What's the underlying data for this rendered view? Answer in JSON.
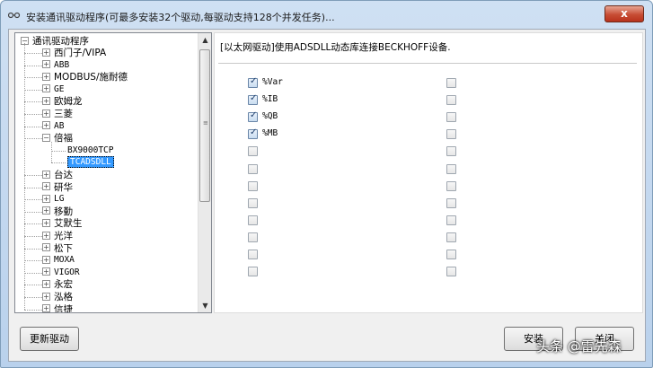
{
  "window": {
    "title": "安装通讯驱动程序(可最多安装32个驱动,每驱动支持128个并发任务)...",
    "close_label": "x"
  },
  "tree": {
    "root_label": "通讯驱动程序",
    "items": [
      {
        "label": "西门子/VIPA",
        "state": "collapsed"
      },
      {
        "label": "ABB",
        "state": "collapsed"
      },
      {
        "label": "MODBUS/施耐德",
        "state": "collapsed"
      },
      {
        "label": "GE",
        "state": "collapsed"
      },
      {
        "label": "欧姆龙",
        "state": "collapsed"
      },
      {
        "label": "三菱",
        "state": "collapsed"
      },
      {
        "label": "AB",
        "state": "collapsed"
      },
      {
        "label": "倍福",
        "state": "expanded"
      },
      {
        "label": "BX9000TCP",
        "state": "child"
      },
      {
        "label": "TCADSDLL",
        "state": "child-selected"
      },
      {
        "label": "台达",
        "state": "collapsed"
      },
      {
        "label": "研华",
        "state": "collapsed"
      },
      {
        "label": "LG",
        "state": "collapsed"
      },
      {
        "label": "移勤",
        "state": "collapsed"
      },
      {
        "label": "艾默生",
        "state": "collapsed"
      },
      {
        "label": "光洋",
        "state": "collapsed"
      },
      {
        "label": "松下",
        "state": "collapsed"
      },
      {
        "label": "MOXA",
        "state": "collapsed"
      },
      {
        "label": "VIGOR",
        "state": "collapsed"
      },
      {
        "label": "永宏",
        "state": "collapsed"
      },
      {
        "label": "泓格",
        "state": "collapsed"
      },
      {
        "label": "信捷",
        "state": "collapsed"
      }
    ]
  },
  "details": {
    "description": "[以太网驱动]使用ADSDLL动态库连接BECKHOFF设备.",
    "left_column": [
      {
        "label": "%Var",
        "checked": true
      },
      {
        "label": "%IB",
        "checked": true
      },
      {
        "label": "%QB",
        "checked": true
      },
      {
        "label": "%MB",
        "checked": true
      },
      {
        "label": "",
        "checked": false
      },
      {
        "label": "",
        "checked": false
      },
      {
        "label": "",
        "checked": false
      },
      {
        "label": "",
        "checked": false
      },
      {
        "label": "",
        "checked": false
      },
      {
        "label": "",
        "checked": false
      },
      {
        "label": "",
        "checked": false
      },
      {
        "label": "",
        "checked": false
      }
    ],
    "right_column_count": 12
  },
  "buttons": {
    "update_driver": "更新驱动",
    "install": "安装",
    "close": "关闭"
  },
  "watermark": "头条 @雷先森"
}
